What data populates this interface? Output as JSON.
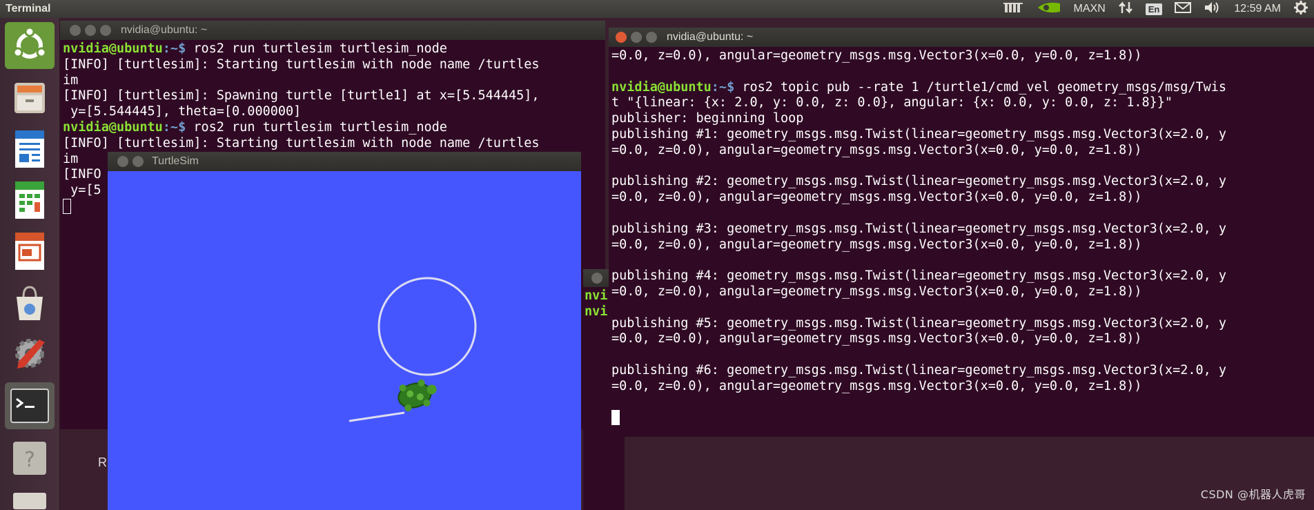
{
  "topbar": {
    "app_title": "Terminal",
    "maxn_label": "MAXN",
    "keyboard_layout": "En",
    "clock": "12:59 AM"
  },
  "term1": {
    "title": "nvidia@ubuntu: ~",
    "prompt_user": "nvidia@ubuntu",
    "prompt_path": ":~$",
    "cmd1": " ros2 run turtlesim turtlesim_node",
    "line2": "[INFO] [turtlesim]: Starting turtlesim with node name /turtles",
    "line3": "im",
    "line4": "[INFO] [turtlesim]: Spawning turtle [turtle1] at x=[5.544445],",
    "line5": " y=[5.544445], theta=[0.000000]",
    "cmd2": " ros2 run turtlesim turtlesim_node",
    "line7": "[INFO] [turtlesim]: Starting turtlesim with node name /turtles",
    "line8": "im",
    "line9": "[INFO",
    "line10": " y=[5"
  },
  "turtlesim": {
    "title": "TurtleSim"
  },
  "term3": {
    "line1": "nvi",
    "line2": "nvi"
  },
  "term2": {
    "title": "nvidia@ubuntu: ~",
    "line0": "=0.0, z=0.0), angular=geometry_msgs.msg.Vector3(x=0.0, y=0.0, z=1.8))",
    "prompt_user": "nvidia@ubuntu",
    "prompt_path": ":~$",
    "cmd": " ros2 topic pub --rate 1 /turtle1/cmd_vel geometry_msgs/msg/Twis",
    "cmd_cont": "t \"{linear: {x: 2.0, y: 0.0, z: 0.0}, angular: {x: 0.0, y: 0.0, z: 1.8}}\"",
    "publisher_line": "publisher: beginning loop",
    "publishing": [
      {
        "a": "publishing #1: geometry_msgs.msg.Twist(linear=geometry_msgs.msg.Vector3(x=2.0, y",
        "b": "=0.0, z=0.0), angular=geometry_msgs.msg.Vector3(x=0.0, y=0.0, z=1.8))"
      },
      {
        "a": "publishing #2: geometry_msgs.msg.Twist(linear=geometry_msgs.msg.Vector3(x=2.0, y",
        "b": "=0.0, z=0.0), angular=geometry_msgs.msg.Vector3(x=0.0, y=0.0, z=1.8))"
      },
      {
        "a": "publishing #3: geometry_msgs.msg.Twist(linear=geometry_msgs.msg.Vector3(x=2.0, y",
        "b": "=0.0, z=0.0), angular=geometry_msgs.msg.Vector3(x=0.0, y=0.0, z=1.8))"
      },
      {
        "a": "publishing #4: geometry_msgs.msg.Twist(linear=geometry_msgs.msg.Vector3(x=2.0, y",
        "b": "=0.0, z=0.0), angular=geometry_msgs.msg.Vector3(x=0.0, y=0.0, z=1.8))"
      },
      {
        "a": "publishing #5: geometry_msgs.msg.Twist(linear=geometry_msgs.msg.Vector3(x=2.0, y",
        "b": "=0.0, z=0.0), angular=geometry_msgs.msg.Vector3(x=0.0, y=0.0, z=1.8))"
      },
      {
        "a": "publishing #6: geometry_msgs.msg.Twist(linear=geometry_msgs.msg.Vector3(x=2.0, y",
        "b": "=0.0, z=0.0), angular=geometry_msgs.msg.Vector3(x=0.0, y=0.0, z=1.8))"
      }
    ]
  },
  "desktop_fragment": "R",
  "watermark": "CSDN @机器人虎哥",
  "colors": {
    "terminal_bg": "#300a24",
    "turtlesim_bg": "#4556ff",
    "prompt_user": "#8ae234",
    "prompt_path": "#729fcf",
    "close_button": "#e05a35"
  }
}
